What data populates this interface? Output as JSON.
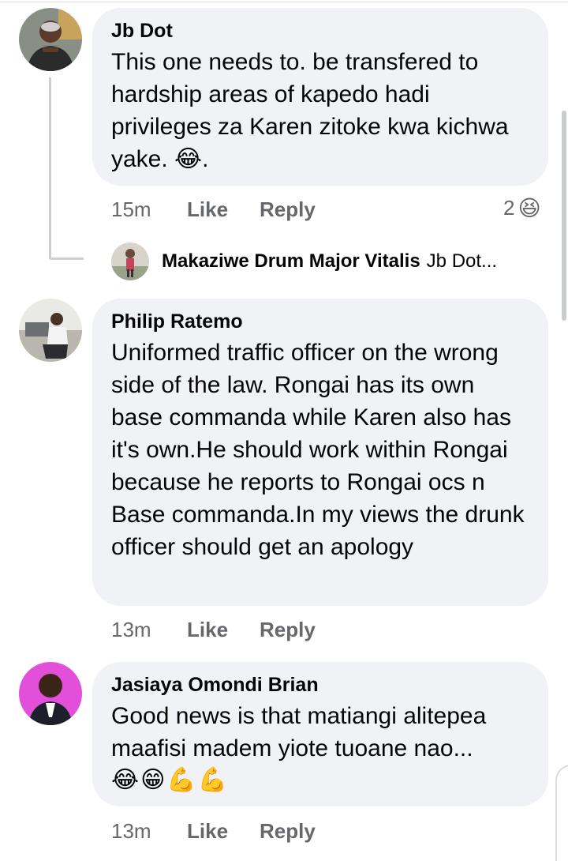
{
  "comments": [
    {
      "author": "Jb Dot",
      "text": "This one needs to. be transfered to hardship areas of kapedo hadi privileges za Karen zitoke kwa kichwa yake. ",
      "text_suffix": ".",
      "inline_emoji": "😂",
      "time": "15m",
      "like_label": "Like",
      "reply_label": "Reply",
      "reaction_count": "2",
      "reaction_emoji": "😆"
    },
    {
      "author": "Philip Ratemo",
      "text": "Uniformed traffic officer on the wrong side of the law. Rongai has its own base commanda while Karen also has it's own.He should work within Rongai because he reports to Rongai ocs n Base commanda.In my views the drunk officer should get an apology",
      "time": "13m",
      "like_label": "Like",
      "reply_label": "Reply"
    },
    {
      "author": "Jasiaya Omondi Brian",
      "text": "Good news is that matiangi alitepea maafisi madem yiote tuoane nao...",
      "emoji_row": [
        "😂",
        "😁",
        "💪",
        "💪"
      ],
      "time": "13m",
      "like_label": "Like",
      "reply_label": "Reply"
    }
  ],
  "reply_preview": {
    "name": "Makaziwe Drum Major Vitalis",
    "preview": "Jb Dot..."
  },
  "colors": {
    "bubble": "#f0f2f5",
    "meta_text": "#65676b",
    "thread_line": "#ccd0d5"
  }
}
